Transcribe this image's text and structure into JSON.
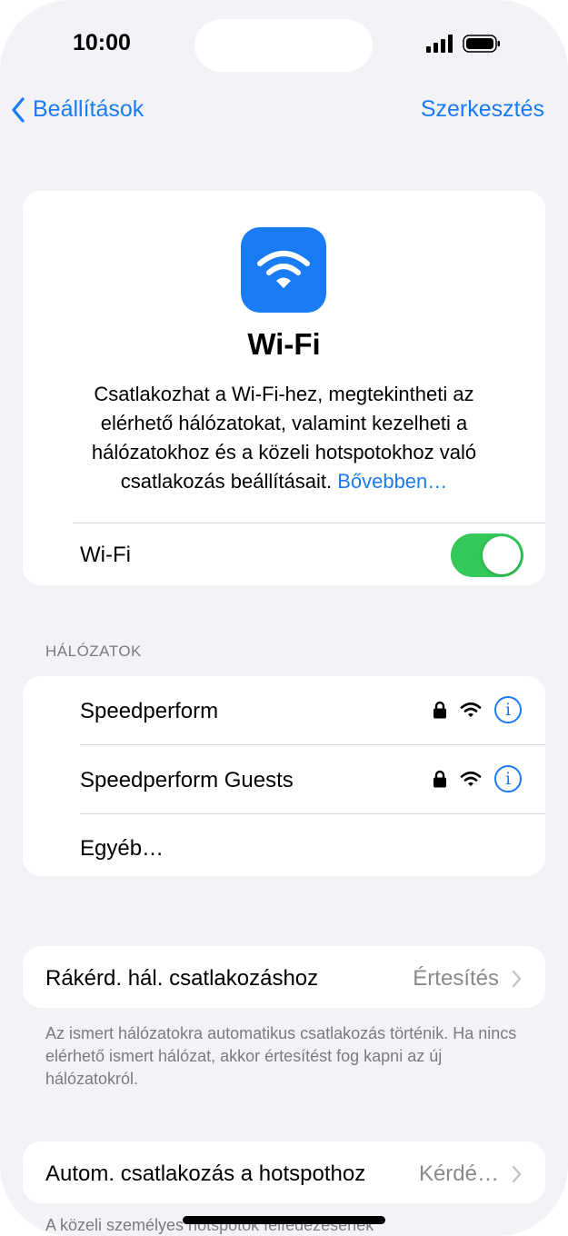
{
  "status": {
    "time": "10:00"
  },
  "nav": {
    "back_label": "Beállítások",
    "edit_label": "Szerkesztés"
  },
  "hero": {
    "icon": "wifi-icon",
    "title": "Wi-Fi",
    "description": "Csatlakozhat a Wi-Fi-hez, megtekintheti az elérhető hálózatokat, valamint kezelheti a hálózatokhoz és a közeli hotspotokhoz való csatlakozás beállításait.",
    "link": "Bővebben…",
    "wifi_row_label": "Wi-Fi",
    "wifi_enabled": true
  },
  "networks": {
    "header": "HÁLÓZATOK",
    "items": [
      {
        "name": "Speedperform",
        "locked": true
      },
      {
        "name": "Speedperform Guests",
        "locked": true
      }
    ],
    "other_label": "Egyéb…"
  },
  "ask_to_join": {
    "label": "Rákérd. hál. csatlakozáshoz",
    "value": "Értesítés",
    "footnote": "Az ismert hálózatokra automatikus csatlakozás történik. Ha nincs elérhető ismert hálózat, akkor értesítést fog kapni az új hálózatokról."
  },
  "auto_hotspot": {
    "label": "Autom. csatlakozás a hotspothoz",
    "value": "Kérdé…",
    "footnote": "A közeli személyes hotspotok felfedezésének"
  },
  "colors": {
    "accent": "#1a7cf5",
    "toggle_on": "#34c759",
    "background": "#f2f2f7"
  }
}
